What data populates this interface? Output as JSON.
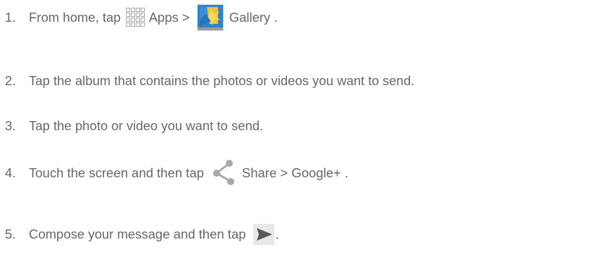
{
  "steps": [
    {
      "number": "1.",
      "text_a": "From home, tap",
      "icon_a": "apps-grid-icon",
      "text_b": "Apps  >",
      "icon_b": "gallery-icon",
      "text_c": "Gallery ."
    },
    {
      "number": "2.",
      "text": "Tap the album that contains the photos or videos you want to send."
    },
    {
      "number": "3.",
      "text": "Tap the photo or video you want to send."
    },
    {
      "number": "4.",
      "text_a": "Touch the screen and then tap",
      "icon_a": "share-icon",
      "text_b": "Share > Google+ ."
    },
    {
      "number": "5.",
      "text_a": "Compose your message and then tap",
      "icon_a": "send-icon",
      "text_b": "."
    }
  ],
  "colors": {
    "text": "#666666",
    "icon_gray": "#a8a8a8",
    "gallery_blue": "#2f82c9",
    "gallery_yellow": "#f5c033"
  }
}
